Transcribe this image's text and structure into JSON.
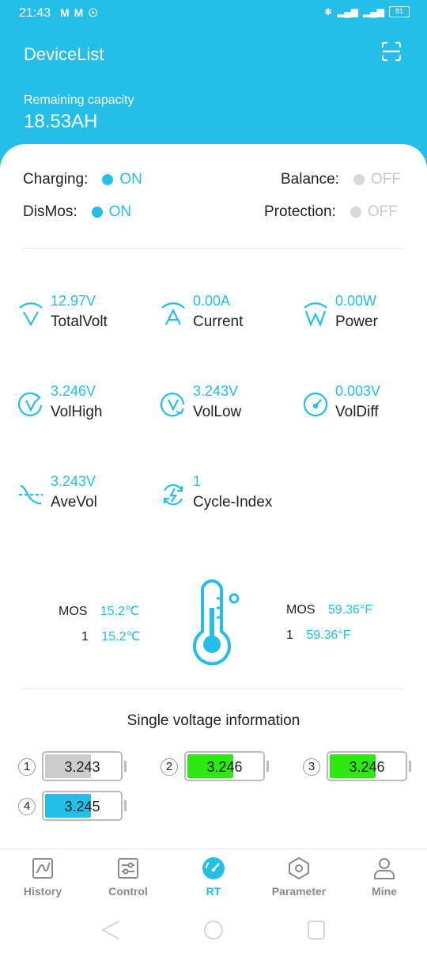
{
  "status": {
    "time": "21:43",
    "battery": "81"
  },
  "header": {
    "title": "DeviceList",
    "capacity_label": "Remaining capacity",
    "capacity_value": "18.53AH"
  },
  "states": {
    "charging_label": "Charging:",
    "charging_value": "ON",
    "balance_label": "Balance:",
    "balance_value": "OFF",
    "dismos_label": "DisMos:",
    "dismos_value": "ON",
    "protection_label": "Protection:",
    "protection_value": "OFF"
  },
  "metrics": [
    {
      "value": "12.97V",
      "label": "TotalVolt",
      "icon": "total-volt-icon"
    },
    {
      "value": "0.00A",
      "label": "Current",
      "icon": "current-icon"
    },
    {
      "value": "0.00W",
      "label": "Power",
      "icon": "power-icon"
    },
    {
      "value": "3.246V",
      "label": "VolHigh",
      "icon": "vol-high-icon"
    },
    {
      "value": "3.243V",
      "label": "VolLow",
      "icon": "vol-low-icon"
    },
    {
      "value": "0.003V",
      "label": "VolDiff",
      "icon": "gauge-icon"
    },
    {
      "value": "3.243V",
      "label": "AveVol",
      "icon": "ave-vol-icon"
    },
    {
      "value": "1",
      "label": "Cycle-Index",
      "icon": "cycle-icon"
    }
  ],
  "temperature": {
    "left": [
      {
        "name": "MOS",
        "value": "15.2℃"
      },
      {
        "name": "1",
        "value": "15.2℃"
      }
    ],
    "right": [
      {
        "name": "MOS",
        "value": "59.36°F"
      },
      {
        "name": "1",
        "value": "59.36°F"
      }
    ]
  },
  "single_voltage": {
    "title": "Single voltage information",
    "cells": [
      {
        "index": "1",
        "value": "3.243",
        "color": "#cccccc",
        "level": 0.6
      },
      {
        "index": "2",
        "value": "3.246",
        "color": "#2ee812",
        "level": 0.6
      },
      {
        "index": "3",
        "value": "3.246",
        "color": "#2ee812",
        "level": 0.6
      },
      {
        "index": "4",
        "value": "3.245",
        "color": "#23bfe8",
        "level": 0.6
      }
    ]
  },
  "tabs": [
    {
      "label": "History",
      "icon": "chart-icon"
    },
    {
      "label": "Control",
      "icon": "sliders-icon"
    },
    {
      "label": "RT",
      "icon": "gauge-icon",
      "active": true
    },
    {
      "label": "Parameter",
      "icon": "hexagon-icon"
    },
    {
      "label": "Mine",
      "icon": "person-icon"
    }
  ],
  "colors": {
    "accent": "#23bfe8",
    "inactive": "#c8c8c8",
    "green": "#2ee812"
  }
}
